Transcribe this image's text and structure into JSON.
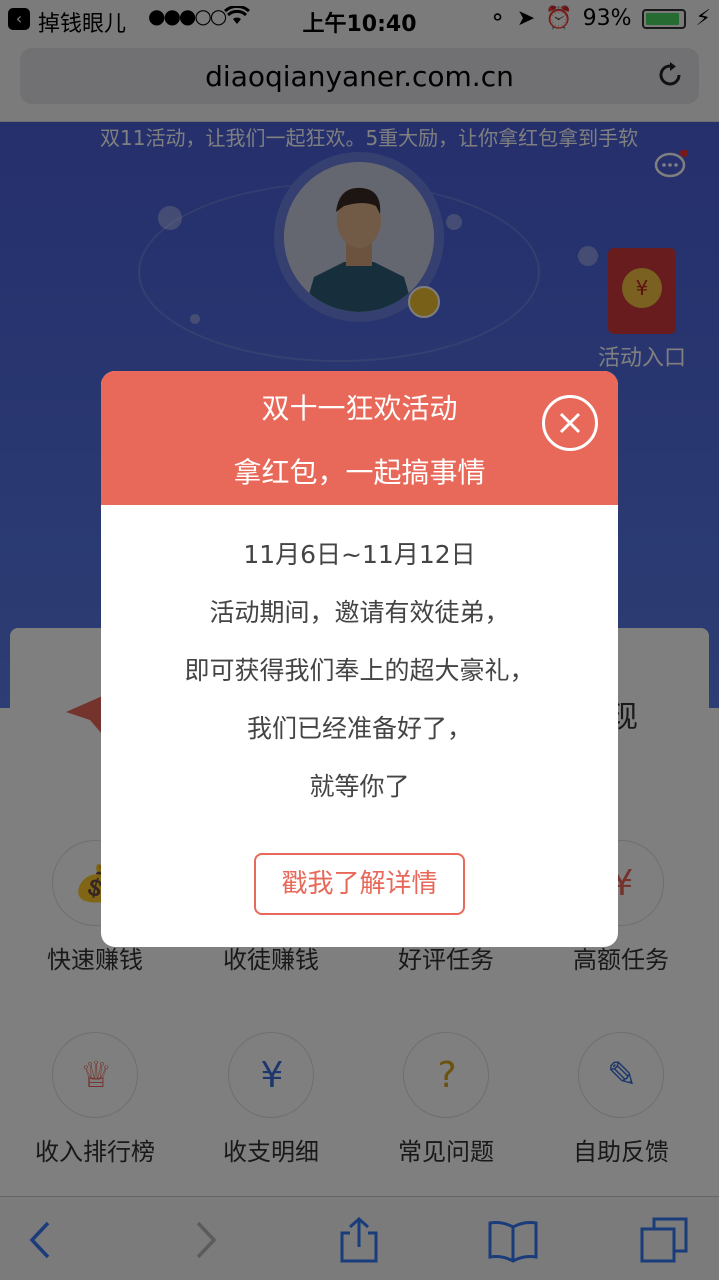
{
  "status_bar": {
    "back_app": "掉钱眼儿",
    "signal": "●●●○○",
    "time": "上午10:40",
    "battery": "93%",
    "battery_level": 0.93
  },
  "browser": {
    "url": "diaoqianyaner.com.cn"
  },
  "page": {
    "marquee": "双11活动，让我们一起狂欢。5重大励，让你拿红包拿到手软",
    "activity_entry": "活动入口",
    "withdraw_fragment": "现",
    "grid": [
      {
        "label": "快速赚钱",
        "icon": "money-bag-icon"
      },
      {
        "label": "收徒赚钱",
        "icon": "disciple-icon"
      },
      {
        "label": "好评任务",
        "icon": "review-icon"
      },
      {
        "label": "高额任务",
        "icon": "high-task-icon"
      },
      {
        "label": "收入排行榜",
        "icon": "crown-icon"
      },
      {
        "label": "收支明细",
        "icon": "clipboard-yen-icon"
      },
      {
        "label": "常见问题",
        "icon": "question-icon"
      },
      {
        "label": "自助反馈",
        "icon": "pen-icon"
      }
    ]
  },
  "modal": {
    "title": "双十一狂欢活动",
    "subtitle": "拿红包，一起搞事情",
    "date_range": "11月6日~11月12日",
    "lines": [
      "活动期间，邀请有效徒弟，",
      "即可获得我们奉上的超大豪礼，",
      "我们已经准备好了，",
      "就等你了"
    ],
    "button": "戳我了解详情"
  },
  "colors": {
    "accent": "#e8695a",
    "hero_blue": "#4a5fd9",
    "ios_blue": "#3478f6"
  }
}
